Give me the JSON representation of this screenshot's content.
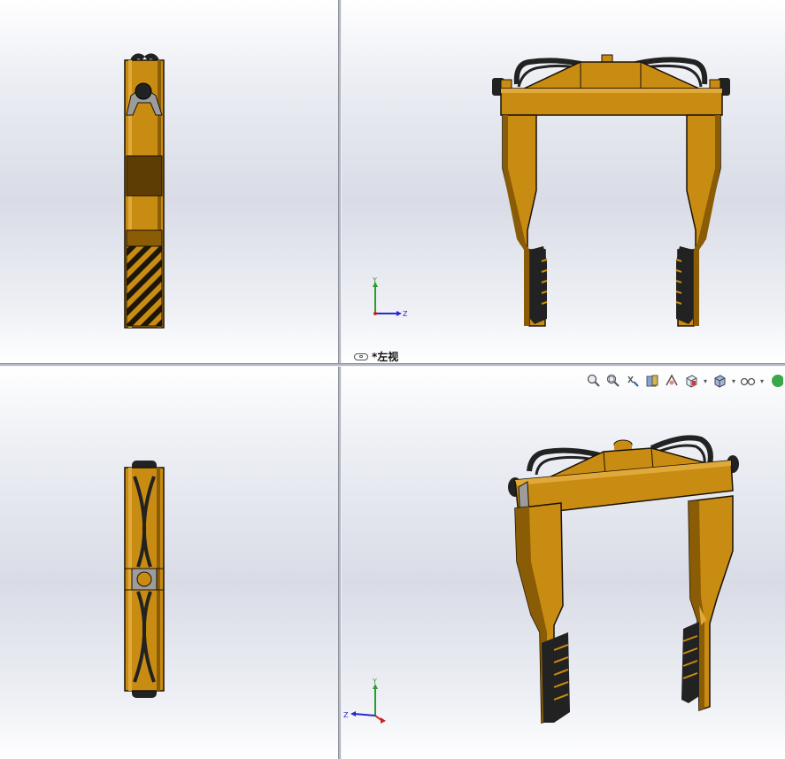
{
  "viewports": {
    "top_right": {
      "label": "*左视"
    }
  },
  "triad": {
    "y_label": "Y",
    "z_label": "Z",
    "colors": {
      "y": "#2e9b2e",
      "z": "#2a2acc",
      "x": "#cc2222"
    }
  },
  "toolbar": {
    "icons": [
      "zoom-to-fit-icon",
      "zoom-to-area-icon",
      "previous-view-icon",
      "section-view-icon",
      "dynamic-annotation-icon",
      "view-orientation-icon",
      "display-style-icon",
      "hide-show-items-icon",
      "edit-appearance-icon"
    ]
  },
  "colors": {
    "body": "#c98c12",
    "body_dark": "#8a5c05",
    "body_light": "#e0a93a",
    "outline": "#1a1205",
    "hose": "#222222",
    "handle_gray": "#9c9c9c",
    "stripe_dark": "#1e1608"
  }
}
